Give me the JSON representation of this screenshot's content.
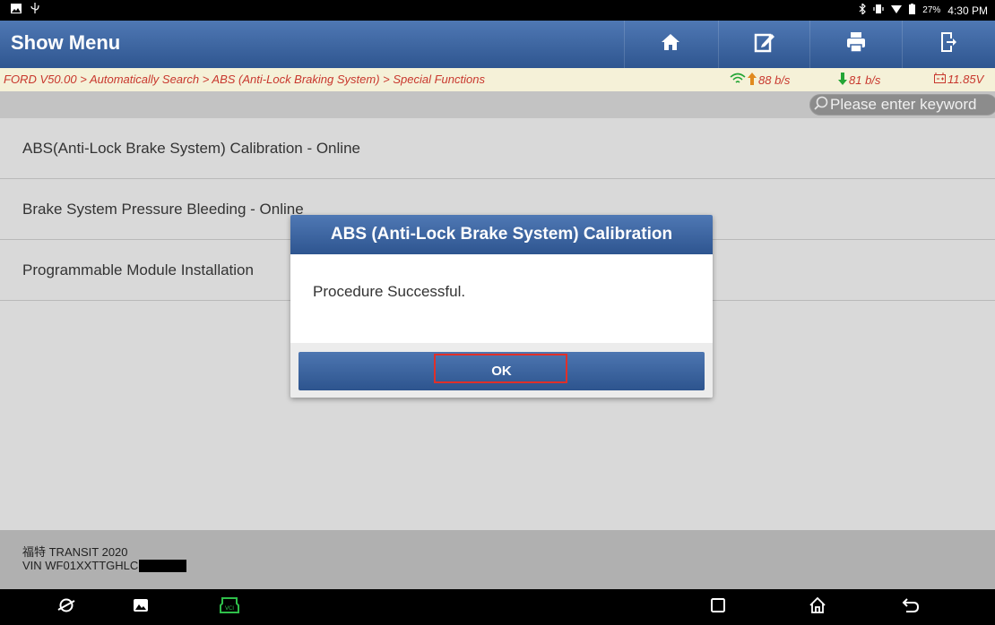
{
  "status_bar": {
    "battery": "27%",
    "time": "4:30 PM"
  },
  "header": {
    "title": "Show Menu",
    "icons": [
      "home-icon",
      "edit-report-icon",
      "print-icon",
      "exit-icon"
    ]
  },
  "breadcrumb": {
    "path": "FORD V50.00 > Automatically Search > ABS (Anti-Lock Braking System) > Special Functions",
    "upload_rate": "88 b/s",
    "download_rate": "81 b/s",
    "voltage": "11.85V"
  },
  "search": {
    "placeholder": "Please enter keyword"
  },
  "menu": {
    "items": [
      {
        "label": "ABS(Anti-Lock Brake System) Calibration - Online"
      },
      {
        "label": "Brake System Pressure Bleeding - Online"
      },
      {
        "label": "Programmable Module Installation"
      }
    ]
  },
  "dialog": {
    "title": "ABS (Anti-Lock Brake System) Calibration",
    "message": "Procedure Successful.",
    "ok_label": "OK"
  },
  "footer": {
    "vehicle": "福特 TRANSIT 2020",
    "vin": "VIN WF01XXTTGHLC"
  },
  "colors": {
    "header_blue": "#3a64a3",
    "breadcrumb_red": "#c8372d",
    "highlight_red": "#e0302a",
    "upload_green": "#23a535"
  }
}
